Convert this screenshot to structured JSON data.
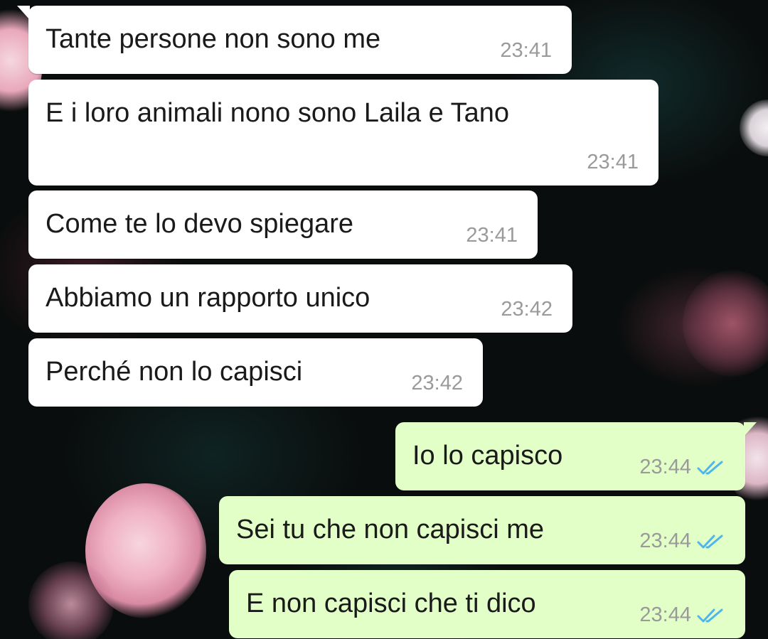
{
  "conversation": {
    "incoming": [
      {
        "text": "Tante persone non sono me",
        "time": "23:41"
      },
      {
        "text": "E i loro animali nono sono  Laila e Tano",
        "time": "23:41"
      },
      {
        "text": "Come te lo devo spiegare",
        "time": "23:41"
      },
      {
        "text": "Abbiamo un rapporto unico",
        "time": "23:42"
      },
      {
        "text": "Perché non lo capisci",
        "time": "23:42"
      }
    ],
    "outgoing": [
      {
        "text": "Io lo capisco",
        "time": "23:44",
        "status_icon": "double-check-read-icon"
      },
      {
        "text": "Sei tu che non capisci me",
        "time": "23:44",
        "status_icon": "double-check-read-icon"
      },
      {
        "text": "E non capisci che ti dico",
        "time": "23:44",
        "status_icon": "double-check-read-icon"
      }
    ]
  },
  "colors": {
    "incoming_bubble": "#ffffff",
    "outgoing_bubble": "#e2ffc8",
    "timestamp": "#9a9a9a",
    "read_tick": "#4fb6ec",
    "wallpaper": "#0a0d0d"
  }
}
